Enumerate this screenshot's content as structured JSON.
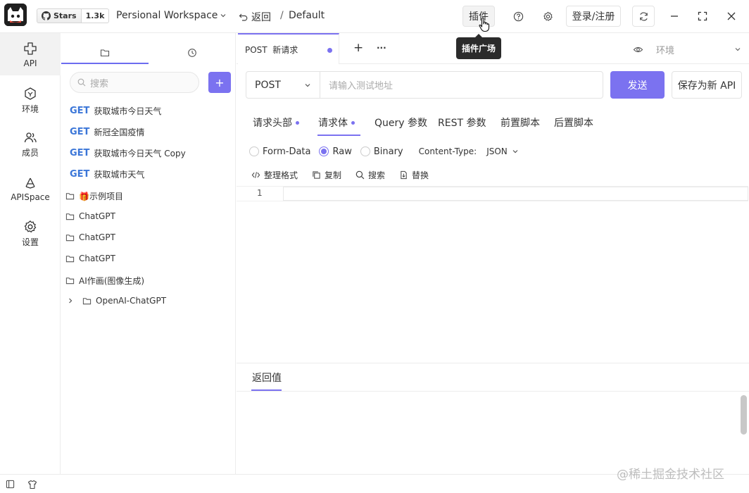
{
  "topbar": {
    "github_label": "Stars",
    "star_count": "1.3k",
    "workspace": "Persional Workspace",
    "back_label": "返回",
    "breadcrumb_sep": "/",
    "breadcrumb": "Default",
    "plugin_label": "插件",
    "tooltip": "插件广场",
    "login_label": "登录/注册"
  },
  "nav": {
    "items": [
      {
        "label": "API",
        "icon": "api-icon"
      },
      {
        "label": "环境",
        "icon": "environment-icon"
      },
      {
        "label": "成员",
        "icon": "members-icon"
      },
      {
        "label": "APISpace",
        "icon": "apispace-icon"
      },
      {
        "label": "设置",
        "icon": "settings-icon"
      }
    ]
  },
  "tree": {
    "search_placeholder": "搜索",
    "add_label": "+",
    "apis": [
      {
        "method": "GET",
        "name": "获取城市今日天气"
      },
      {
        "method": "GET",
        "name": "新冠全国疫情"
      },
      {
        "method": "GET",
        "name": "获取城市今日天气 Copy"
      },
      {
        "method": "GET",
        "name": "获取城市天气"
      }
    ],
    "folders": [
      {
        "name": "🎁示例项目"
      },
      {
        "name": "ChatGPT"
      },
      {
        "name": "ChatGPT"
      },
      {
        "name": "ChatGPT"
      },
      {
        "name": "AI作画(图像生成)"
      },
      {
        "name": "OpenAI-ChatGPT"
      }
    ]
  },
  "request": {
    "tab_label": "POST  新请求",
    "add_tab": "+",
    "more": "···",
    "env_label": "环境",
    "method": "POST",
    "url_placeholder": "请输入测试地址",
    "send_label": "发送",
    "save_label": "保存为新 API",
    "sub_tabs": [
      "请求头部",
      "请求体",
      "Query 参数",
      "REST 参数",
      "前置脚本",
      "后置脚本"
    ],
    "body_types": [
      "Form-Data",
      "Raw",
      "Binary"
    ],
    "selected_body_type": "Raw",
    "content_type_label": "Content-Type:",
    "content_type": "JSON",
    "tools": [
      "整理格式",
      "复制",
      "搜索",
      "替换"
    ],
    "line_number": "1"
  },
  "response": {
    "tab_label": "返回值"
  },
  "watermark": "@稀土掘金技术社区",
  "colors": {
    "accent": "#7b72f0",
    "get_method": "#3b76d8"
  }
}
